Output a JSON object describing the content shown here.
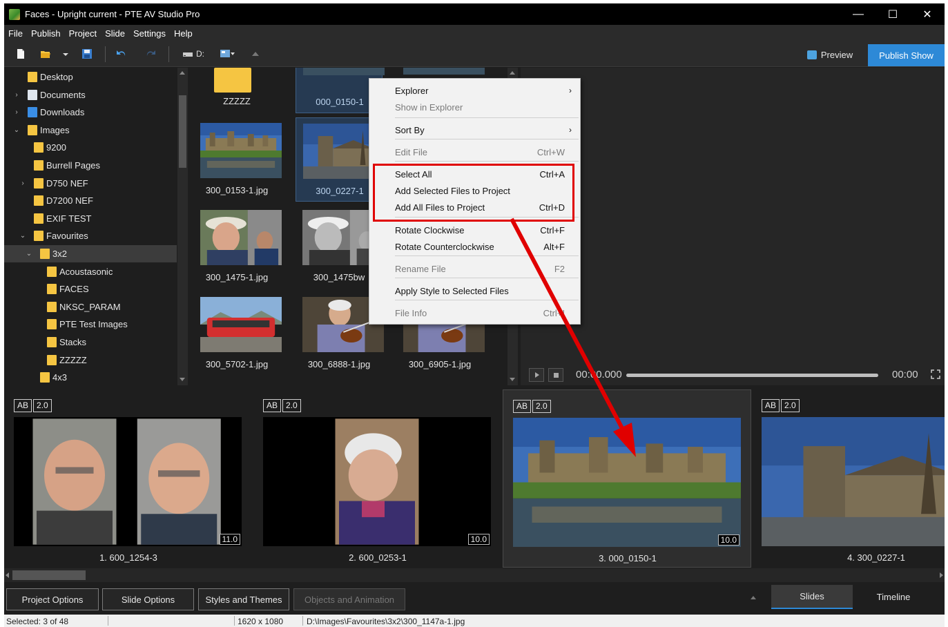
{
  "window": {
    "title": "Faces - Upright current - PTE AV Studio Pro",
    "minimize": "—",
    "maximize": "☐",
    "close": "✕"
  },
  "menu": [
    "File",
    "Publish",
    "Project",
    "Slide",
    "Settings",
    "Help"
  ],
  "toolbar": {
    "drive_label": "D:",
    "preview_label": "Preview",
    "publish_label": "Publish Show"
  },
  "tree": [
    {
      "label": "Desktop",
      "depth": 0,
      "chevron": "",
      "selected": false
    },
    {
      "label": "Documents",
      "depth": 0,
      "chevron": "›",
      "selected": false
    },
    {
      "label": "Downloads",
      "depth": 0,
      "chevron": "›",
      "selected": false
    },
    {
      "label": "Images",
      "depth": 0,
      "chevron": "⌄",
      "selected": false
    },
    {
      "label": "9200",
      "depth": 1,
      "chevron": "",
      "selected": false
    },
    {
      "label": "Burrell Pages",
      "depth": 1,
      "chevron": "",
      "selected": false
    },
    {
      "label": "D750 NEF",
      "depth": 1,
      "chevron": "›",
      "selected": false
    },
    {
      "label": "D7200 NEF",
      "depth": 1,
      "chevron": "",
      "selected": false
    },
    {
      "label": "EXIF TEST",
      "depth": 1,
      "chevron": "",
      "selected": false
    },
    {
      "label": "Favourites",
      "depth": 1,
      "chevron": "⌄",
      "selected": false
    },
    {
      "label": "3x2",
      "depth": 2,
      "chevron": "⌄",
      "selected": true
    },
    {
      "label": "Acoustasonic",
      "depth": 3,
      "chevron": "",
      "selected": false
    },
    {
      "label": "FACES",
      "depth": 3,
      "chevron": "",
      "selected": false
    },
    {
      "label": "NKSC_PARAM",
      "depth": 3,
      "chevron": "",
      "selected": false
    },
    {
      "label": "PTE Test Images",
      "depth": 3,
      "chevron": "",
      "selected": false
    },
    {
      "label": "Stacks",
      "depth": 3,
      "chevron": "",
      "selected": false
    },
    {
      "label": "ZZZZZ",
      "depth": 3,
      "chevron": "",
      "selected": false
    },
    {
      "label": "4x3",
      "depth": 2,
      "chevron": "",
      "selected": false
    }
  ],
  "files": [
    {
      "name": "ZZZZZ",
      "kind": "folder",
      "selected": false
    },
    {
      "name": "000_0150-1",
      "kind": "castle",
      "selected": true
    },
    {
      "name": "",
      "kind": "castle",
      "selected": false
    },
    {
      "name": "300_0153-1.jpg",
      "kind": "castle",
      "selected": false
    },
    {
      "name": "300_0227-1",
      "kind": "church",
      "selected": true
    },
    {
      "name": "",
      "kind": "hidden",
      "selected": false
    },
    {
      "name": "300_1475-1.jpg",
      "kind": "man",
      "selected": false
    },
    {
      "name": "300_1475bw",
      "kind": "manbw",
      "selected": false
    },
    {
      "name": "",
      "kind": "hidden",
      "selected": false
    },
    {
      "name": "300_5702-1.jpg",
      "kind": "tram",
      "selected": false
    },
    {
      "name": "300_6888-1.jpg",
      "kind": "violin",
      "selected": false
    },
    {
      "name": "300_6905-1.jpg",
      "kind": "violin",
      "selected": false
    }
  ],
  "player": {
    "time_start": "00:00.000",
    "time_end": "00:00",
    "position": 0
  },
  "context_menu": {
    "items": [
      {
        "label": "Explorer",
        "shortcut": "",
        "submenu": true,
        "disabled": false
      },
      {
        "label": "Show in Explorer",
        "shortcut": "",
        "submenu": false,
        "disabled": true
      },
      {
        "label": "Sort By",
        "shortcut": "",
        "submenu": true,
        "disabled": false
      },
      {
        "label": "Edit File",
        "shortcut": "Ctrl+W",
        "submenu": false,
        "disabled": true
      },
      {
        "label": "Select All",
        "shortcut": "Ctrl+A",
        "submenu": false,
        "disabled": false
      },
      {
        "label": "Add Selected Files to Project",
        "shortcut": "",
        "submenu": false,
        "disabled": false
      },
      {
        "label": "Add All Files to Project",
        "shortcut": "Ctrl+D",
        "submenu": false,
        "disabled": false
      },
      {
        "label": "Rotate Clockwise",
        "shortcut": "Ctrl+F",
        "submenu": false,
        "disabled": false
      },
      {
        "label": "Rotate Counterclockwise",
        "shortcut": "Alt+F",
        "submenu": false,
        "disabled": false
      },
      {
        "label": "Rename File",
        "shortcut": "F2",
        "submenu": false,
        "disabled": true
      },
      {
        "label": "Apply Style to Selected Files",
        "shortcut": "",
        "submenu": false,
        "disabled": false
      },
      {
        "label": "File Info",
        "shortcut": "Ctrl+I",
        "submenu": false,
        "disabled": true
      }
    ]
  },
  "slides": [
    {
      "name": "1. 600_1254-3",
      "badge_ab": "AB",
      "badge_time": "2.0",
      "duration": "11.0",
      "selected": false,
      "kind": "twofaces"
    },
    {
      "name": "2. 600_0253-1",
      "badge_ab": "AB",
      "badge_time": "2.0",
      "duration": "10.0",
      "selected": false,
      "kind": "oneface"
    },
    {
      "name": "3. 000_0150-1",
      "badge_ab": "AB",
      "badge_time": "2.0",
      "duration": "10.0",
      "selected": true,
      "kind": "castle"
    },
    {
      "name": "4. 300_0227-1",
      "badge_ab": "AB",
      "badge_time": "2.0",
      "duration": "",
      "selected": false,
      "kind": "church"
    }
  ],
  "bottom": {
    "project_options": "Project Options",
    "slide_options": "Slide Options",
    "styles_themes": "Styles and Themes",
    "objects_animation": "Objects and Animation",
    "tab_slides": "Slides",
    "tab_timeline": "Timeline"
  },
  "status": {
    "selected": "Selected: 3 of 48",
    "resolution": "1620 x 1080",
    "path": "D:\\Images\\Favourites\\3x2\\300_1147a-1.jpg"
  },
  "colors": {
    "accent": "#2d89d7",
    "highlight": "#e00000",
    "folder": "#f5c542",
    "background": "#1e1e1e"
  }
}
